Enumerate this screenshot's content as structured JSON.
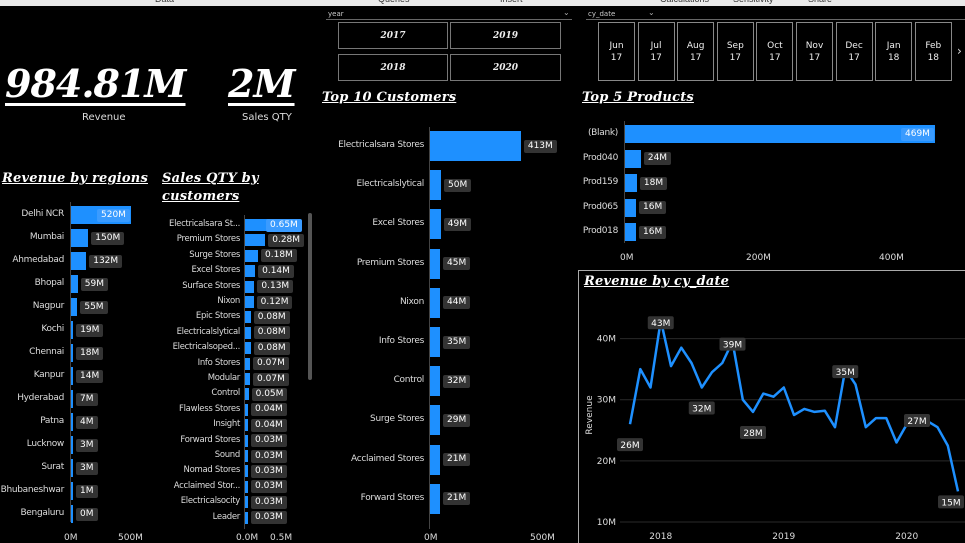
{
  "ribbon": {
    "tabs": [
      "Data",
      "Queries",
      "Insert",
      "Calculations",
      "Sensitivity",
      "Share"
    ]
  },
  "kpis": {
    "revenue_value": "984.81M",
    "revenue_label": "Revenue",
    "qty_value": "2M",
    "qty_label": "Sales QTY"
  },
  "slicer_year": {
    "title": "year",
    "options": [
      "2017",
      "2019",
      "2018",
      "2020"
    ]
  },
  "slicer_date": {
    "title": "cy_date",
    "items": [
      {
        "m": "Jun",
        "y": "17"
      },
      {
        "m": "Jul",
        "y": "17"
      },
      {
        "m": "Aug",
        "y": "17"
      },
      {
        "m": "Sep",
        "y": "17"
      },
      {
        "m": "Oct",
        "y": "17"
      },
      {
        "m": "Nov",
        "y": "17"
      },
      {
        "m": "Dec",
        "y": "17"
      },
      {
        "m": "Jan",
        "y": "18"
      },
      {
        "m": "Feb",
        "y": "18"
      }
    ]
  },
  "colors": {
    "bar": "#1e90ff",
    "label_bg": "#333333",
    "bg": "#000000"
  },
  "chart_data": [
    {
      "id": "regions",
      "type": "bar",
      "title": "Revenue by regions",
      "orientation": "horizontal",
      "categories": [
        "Delhi NCR",
        "Mumbai",
        "Ahmedabad",
        "Bhopal",
        "Nagpur",
        "Kochi",
        "Chennai",
        "Kanpur",
        "Hyderabad",
        "Patna",
        "Lucknow",
        "Surat",
        "Bhubaneshwar",
        "Bengaluru"
      ],
      "values": [
        520,
        150,
        132,
        59,
        55,
        19,
        18,
        14,
        7,
        4,
        3,
        3,
        1,
        0
      ],
      "labels": [
        "520M",
        "150M",
        "132M",
        "59M",
        "55M",
        "19M",
        "18M",
        "14M",
        "7M",
        "4M",
        "3M",
        "3M",
        "1M",
        "0M"
      ],
      "xticks": [
        "0M",
        "500M"
      ],
      "xlim": [
        0,
        500
      ]
    },
    {
      "id": "qty_customers",
      "type": "bar",
      "title": "Sales QTY by customers",
      "title_lines": [
        "Sales QTY by",
        "customers"
      ],
      "orientation": "horizontal",
      "categories": [
        "Electricalsara St...",
        "Premium Stores",
        "Surge Stores",
        "Excel Stores",
        "Surface Stores",
        "Nixon",
        "Epic Stores",
        "Electricalslytical",
        "Electricalsoped...",
        "Info Stores",
        "Modular",
        "Control",
        "Flawless Stores",
        "Insight",
        "Forward Stores",
        "Sound",
        "Nomad Stores",
        "Acclaimed Stor...",
        "Electricalsocity",
        "Leader"
      ],
      "values": [
        0.65,
        0.28,
        0.18,
        0.14,
        0.13,
        0.12,
        0.08,
        0.08,
        0.08,
        0.07,
        0.07,
        0.05,
        0.04,
        0.04,
        0.03,
        0.03,
        0.03,
        0.03,
        0.03,
        0.03
      ],
      "labels": [
        "0.65M",
        "0.28M",
        "0.18M",
        "0.14M",
        "0.13M",
        "0.12M",
        "0.08M",
        "0.08M",
        "0.08M",
        "0.07M",
        "0.07M",
        "0.05M",
        "0.04M",
        "0.04M",
        "0.03M",
        "0.03M",
        "0.03M",
        "0.03M",
        "0.03M",
        "0.03M"
      ],
      "xticks": [
        "0.0M",
        "0.5M"
      ],
      "xlim": [
        0,
        0.5
      ]
    },
    {
      "id": "top10",
      "type": "bar",
      "title": "Top 10 Customers",
      "orientation": "horizontal",
      "categories": [
        "Electricalsara Stores",
        "Electricalslytical",
        "Excel Stores",
        "Premium Stores",
        "Nixon",
        "Info Stores",
        "Control",
        "Surge Stores",
        "Acclaimed Stores",
        "Forward Stores"
      ],
      "values": [
        413,
        50,
        49,
        45,
        44,
        35,
        32,
        29,
        21,
        21
      ],
      "labels": [
        "413M",
        "50M",
        "49M",
        "45M",
        "44M",
        "35M",
        "32M",
        "29M",
        "21M",
        "21M"
      ],
      "xticks": [
        "0M",
        "500M"
      ],
      "xlim": [
        0,
        500
      ]
    },
    {
      "id": "top5",
      "type": "bar",
      "title": "Top 5 Products",
      "orientation": "horizontal",
      "categories": [
        "(Blank)",
        "Prod040",
        "Prod159",
        "Prod065",
        "Prod018"
      ],
      "values": [
        469,
        24,
        18,
        16,
        16
      ],
      "labels": [
        "469M",
        "24M",
        "18M",
        "16M",
        "16M"
      ],
      "xticks": [
        "0M",
        "200M",
        "400M"
      ],
      "xlim": [
        0,
        469
      ]
    },
    {
      "id": "revenue_date",
      "type": "line",
      "title": "Revenue by cy_date",
      "ylabel": "Revenue",
      "yticks": [
        "10M",
        "20M",
        "30M",
        "40M"
      ],
      "ylim": [
        10,
        45
      ],
      "xticks": [
        "2018",
        "2019",
        "2020"
      ],
      "x": [
        "2017-10",
        "2017-11",
        "2017-12",
        "2018-01",
        "2018-02",
        "2018-03",
        "2018-04",
        "2018-05",
        "2018-06",
        "2018-07",
        "2018-08",
        "2018-09",
        "2018-10",
        "2018-11",
        "2018-12",
        "2019-01",
        "2019-02",
        "2019-03",
        "2019-04",
        "2019-05",
        "2019-06",
        "2019-07",
        "2019-08",
        "2019-09",
        "2019-10",
        "2019-11",
        "2019-12",
        "2020-01",
        "2020-02",
        "2020-03",
        "2020-04",
        "2020-05",
        "2020-06"
      ],
      "values": [
        26,
        35,
        32,
        43,
        35.5,
        38.5,
        36,
        32,
        34.5,
        36,
        39.5,
        30,
        28,
        31,
        30.5,
        32,
        27.5,
        28.5,
        28,
        28.2,
        25.5,
        35,
        32.5,
        25.5,
        27,
        27,
        23,
        26,
        27,
        26.5,
        25.5,
        22.5,
        15
      ],
      "point_labels": [
        {
          "i": 0,
          "text": "26M"
        },
        {
          "i": 3,
          "text": "43M"
        },
        {
          "i": 7,
          "text": "32M"
        },
        {
          "i": 10,
          "text": "39M"
        },
        {
          "i": 12,
          "text": "28M"
        },
        {
          "i": 21,
          "text": "35M"
        },
        {
          "i": 28,
          "text": "27M"
        },
        {
          "i": 32,
          "text": "15M"
        }
      ]
    }
  ]
}
